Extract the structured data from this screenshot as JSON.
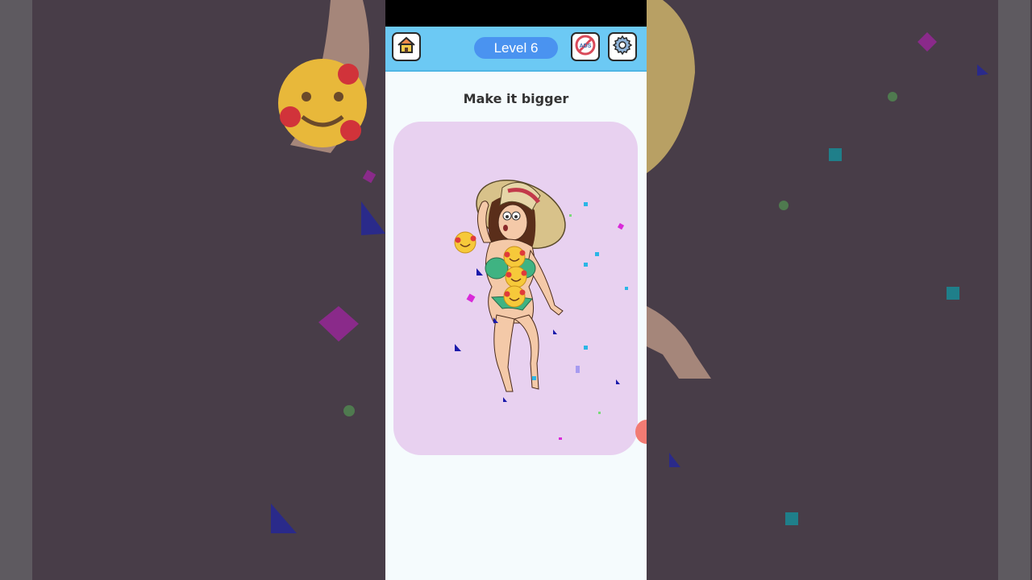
{
  "game": {
    "level_label": "Level 6",
    "prompt": "Make it bigger",
    "no_ads_badge": "ADS"
  },
  "icons": {
    "home": "home-icon",
    "no_ads": "no-ads-icon",
    "settings": "gear-icon",
    "emoji": "smiling-face-with-hearts"
  },
  "colors": {
    "top_bar": "#6cc9f4",
    "level_pill": "#4a93f0",
    "card": "#e8d1f0",
    "page": "#f5fbfd"
  }
}
